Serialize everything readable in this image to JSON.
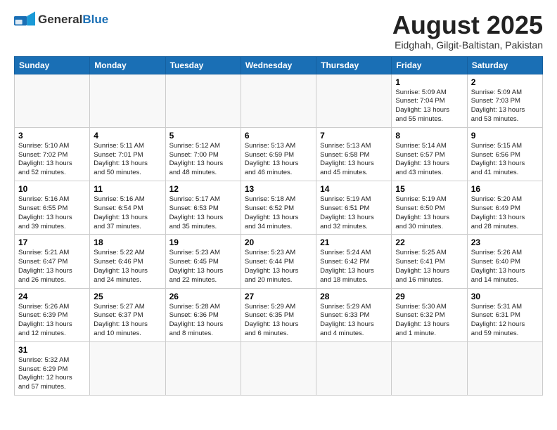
{
  "header": {
    "logo_general": "General",
    "logo_blue": "Blue",
    "title": "August 2025",
    "subtitle": "Eidghah, Gilgit-Baltistan, Pakistan"
  },
  "weekdays": [
    "Sunday",
    "Monday",
    "Tuesday",
    "Wednesday",
    "Thursday",
    "Friday",
    "Saturday"
  ],
  "weeks": [
    [
      {
        "day": "",
        "info": ""
      },
      {
        "day": "",
        "info": ""
      },
      {
        "day": "",
        "info": ""
      },
      {
        "day": "",
        "info": ""
      },
      {
        "day": "",
        "info": ""
      },
      {
        "day": "1",
        "info": "Sunrise: 5:09 AM\nSunset: 7:04 PM\nDaylight: 13 hours\nand 55 minutes."
      },
      {
        "day": "2",
        "info": "Sunrise: 5:09 AM\nSunset: 7:03 PM\nDaylight: 13 hours\nand 53 minutes."
      }
    ],
    [
      {
        "day": "3",
        "info": "Sunrise: 5:10 AM\nSunset: 7:02 PM\nDaylight: 13 hours\nand 52 minutes."
      },
      {
        "day": "4",
        "info": "Sunrise: 5:11 AM\nSunset: 7:01 PM\nDaylight: 13 hours\nand 50 minutes."
      },
      {
        "day": "5",
        "info": "Sunrise: 5:12 AM\nSunset: 7:00 PM\nDaylight: 13 hours\nand 48 minutes."
      },
      {
        "day": "6",
        "info": "Sunrise: 5:13 AM\nSunset: 6:59 PM\nDaylight: 13 hours\nand 46 minutes."
      },
      {
        "day": "7",
        "info": "Sunrise: 5:13 AM\nSunset: 6:58 PM\nDaylight: 13 hours\nand 45 minutes."
      },
      {
        "day": "8",
        "info": "Sunrise: 5:14 AM\nSunset: 6:57 PM\nDaylight: 13 hours\nand 43 minutes."
      },
      {
        "day": "9",
        "info": "Sunrise: 5:15 AM\nSunset: 6:56 PM\nDaylight: 13 hours\nand 41 minutes."
      }
    ],
    [
      {
        "day": "10",
        "info": "Sunrise: 5:16 AM\nSunset: 6:55 PM\nDaylight: 13 hours\nand 39 minutes."
      },
      {
        "day": "11",
        "info": "Sunrise: 5:16 AM\nSunset: 6:54 PM\nDaylight: 13 hours\nand 37 minutes."
      },
      {
        "day": "12",
        "info": "Sunrise: 5:17 AM\nSunset: 6:53 PM\nDaylight: 13 hours\nand 35 minutes."
      },
      {
        "day": "13",
        "info": "Sunrise: 5:18 AM\nSunset: 6:52 PM\nDaylight: 13 hours\nand 34 minutes."
      },
      {
        "day": "14",
        "info": "Sunrise: 5:19 AM\nSunset: 6:51 PM\nDaylight: 13 hours\nand 32 minutes."
      },
      {
        "day": "15",
        "info": "Sunrise: 5:19 AM\nSunset: 6:50 PM\nDaylight: 13 hours\nand 30 minutes."
      },
      {
        "day": "16",
        "info": "Sunrise: 5:20 AM\nSunset: 6:49 PM\nDaylight: 13 hours\nand 28 minutes."
      }
    ],
    [
      {
        "day": "17",
        "info": "Sunrise: 5:21 AM\nSunset: 6:47 PM\nDaylight: 13 hours\nand 26 minutes."
      },
      {
        "day": "18",
        "info": "Sunrise: 5:22 AM\nSunset: 6:46 PM\nDaylight: 13 hours\nand 24 minutes."
      },
      {
        "day": "19",
        "info": "Sunrise: 5:23 AM\nSunset: 6:45 PM\nDaylight: 13 hours\nand 22 minutes."
      },
      {
        "day": "20",
        "info": "Sunrise: 5:23 AM\nSunset: 6:44 PM\nDaylight: 13 hours\nand 20 minutes."
      },
      {
        "day": "21",
        "info": "Sunrise: 5:24 AM\nSunset: 6:42 PM\nDaylight: 13 hours\nand 18 minutes."
      },
      {
        "day": "22",
        "info": "Sunrise: 5:25 AM\nSunset: 6:41 PM\nDaylight: 13 hours\nand 16 minutes."
      },
      {
        "day": "23",
        "info": "Sunrise: 5:26 AM\nSunset: 6:40 PM\nDaylight: 13 hours\nand 14 minutes."
      }
    ],
    [
      {
        "day": "24",
        "info": "Sunrise: 5:26 AM\nSunset: 6:39 PM\nDaylight: 13 hours\nand 12 minutes."
      },
      {
        "day": "25",
        "info": "Sunrise: 5:27 AM\nSunset: 6:37 PM\nDaylight: 13 hours\nand 10 minutes."
      },
      {
        "day": "26",
        "info": "Sunrise: 5:28 AM\nSunset: 6:36 PM\nDaylight: 13 hours\nand 8 minutes."
      },
      {
        "day": "27",
        "info": "Sunrise: 5:29 AM\nSunset: 6:35 PM\nDaylight: 13 hours\nand 6 minutes."
      },
      {
        "day": "28",
        "info": "Sunrise: 5:29 AM\nSunset: 6:33 PM\nDaylight: 13 hours\nand 4 minutes."
      },
      {
        "day": "29",
        "info": "Sunrise: 5:30 AM\nSunset: 6:32 PM\nDaylight: 13 hours\nand 1 minute."
      },
      {
        "day": "30",
        "info": "Sunrise: 5:31 AM\nSunset: 6:31 PM\nDaylight: 12 hours\nand 59 minutes."
      }
    ],
    [
      {
        "day": "31",
        "info": "Sunrise: 5:32 AM\nSunset: 6:29 PM\nDaylight: 12 hours\nand 57 minutes."
      },
      {
        "day": "",
        "info": ""
      },
      {
        "day": "",
        "info": ""
      },
      {
        "day": "",
        "info": ""
      },
      {
        "day": "",
        "info": ""
      },
      {
        "day": "",
        "info": ""
      },
      {
        "day": "",
        "info": ""
      }
    ]
  ]
}
